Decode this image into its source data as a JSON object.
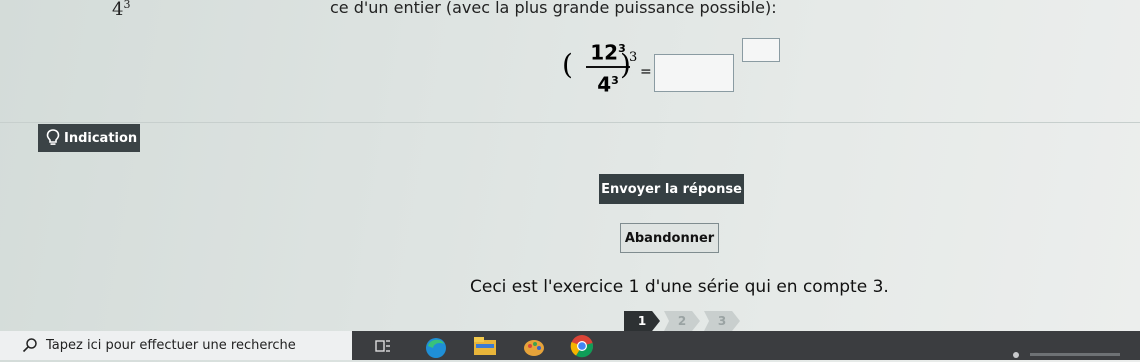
{
  "question": {
    "power_fragment_base": "4",
    "power_fragment_exp": "3",
    "instruction_tail": "ce d'un entier (avec la plus grande puissance possible):"
  },
  "expression": {
    "open_paren": "(",
    "numerator_base": "12",
    "numerator_exp": "3",
    "denominator_base": "4",
    "denominator_exp": "3",
    "close_paren": ")",
    "outer_exp": "3",
    "equals": "="
  },
  "hint": {
    "label": "Indication"
  },
  "buttons": {
    "submit": "Envoyer la réponse",
    "abandon": "Abandonner"
  },
  "info_text": "Ceci est l'exercice 1 d'une série qui en compte 3.",
  "steps": [
    "1",
    "2",
    "3"
  ],
  "taskbar": {
    "search_placeholder": "Tapez ici pour effectuer une recherche",
    "icons": [
      "task-view-icon",
      "edge-icon",
      "file-explorer-icon",
      "paint-icon",
      "chrome-icon"
    ]
  }
}
